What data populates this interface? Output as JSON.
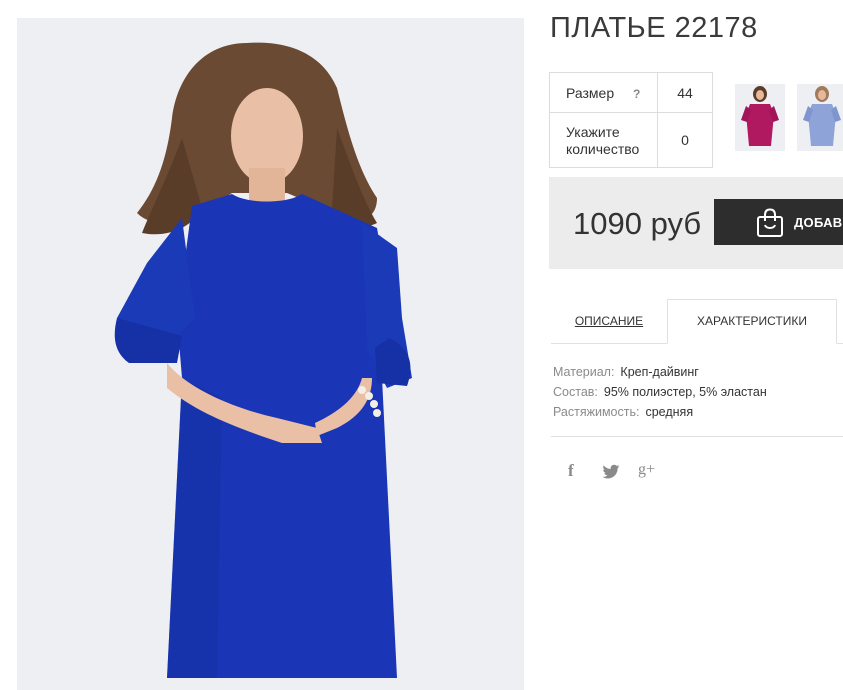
{
  "product": {
    "title": "ПЛАТЬЕ 22178",
    "main_image": {
      "icon": "dress-photo",
      "dress_color": "#1a35b5"
    }
  },
  "options": {
    "size_label": "Размер",
    "size_help": "?",
    "size_value": "44",
    "qty_label_line1": "Укажите",
    "qty_label_line2": "количество",
    "qty_value": "0"
  },
  "thumbnails": [
    {
      "icon": "dress-thumbnail-magenta",
      "color": "#b0195f"
    },
    {
      "icon": "dress-thumbnail-light-blue",
      "color": "#8ea3d8"
    }
  ],
  "price": {
    "value": "1090 руб",
    "buy_label": "ДОБАВИ"
  },
  "tabs": [
    {
      "label": "ОПИСАНИЕ"
    },
    {
      "label": "ХАРАКТЕРИСТИКИ",
      "active": true
    }
  ],
  "specs": [
    {
      "key": "Материал:",
      "value": "Креп-дайвинг"
    },
    {
      "key": "Состав:",
      "value": "95% полиэстер, 5% эластан"
    },
    {
      "key": "Растяжимость:",
      "value": "средняя"
    }
  ],
  "social": {
    "facebook": "f",
    "twitter_icon": "twitter-icon",
    "googleplus": "g+"
  }
}
